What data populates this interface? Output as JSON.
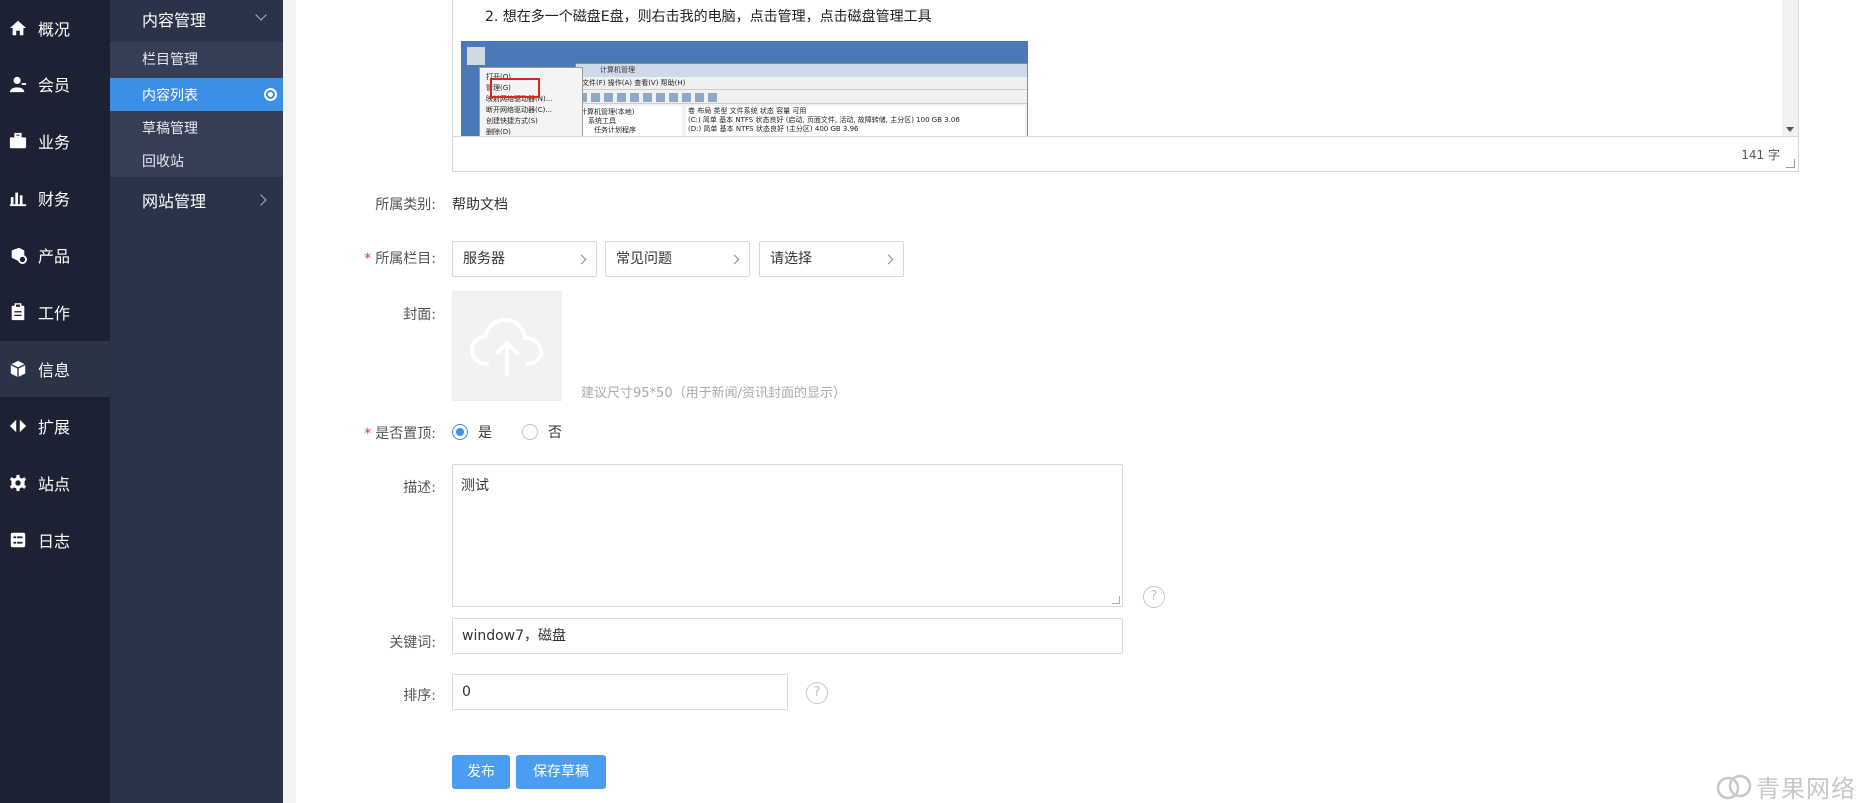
{
  "primary_nav": [
    {
      "label": "概况",
      "icon": "home-icon"
    },
    {
      "label": "会员",
      "icon": "user-icon"
    },
    {
      "label": "业务",
      "icon": "briefcase-icon"
    },
    {
      "label": "财务",
      "icon": "bar-chart-icon"
    },
    {
      "label": "产品",
      "icon": "product-icon"
    },
    {
      "label": "工作",
      "icon": "clipboard-icon"
    },
    {
      "label": "信息",
      "icon": "cube-icon"
    },
    {
      "label": "扩展",
      "icon": "code-icon"
    },
    {
      "label": "站点",
      "icon": "gear-icon"
    },
    {
      "label": "日志",
      "icon": "log-icon"
    }
  ],
  "secondary_nav": {
    "content_group": "内容管理",
    "items": [
      "栏目管理",
      "内容列表",
      "草稿管理",
      "回收站"
    ],
    "site_group": "网站管理"
  },
  "editor": {
    "line": "2. 想在多一个磁盘E盘，则右击我的电脑，点击管理，点击磁盘管理工具",
    "word_count": "141 字",
    "screenshot": {
      "window_title": "计算机管理",
      "menu": "文件(F)   操作(A)   查看(V)   帮助(H)",
      "context_menu": [
        "打开(O)",
        "管理(G)",
        "映射网络驱动器(N)...",
        "断开网络驱动器(C)...",
        "创建快捷方式(S)",
        "删除(D)"
      ],
      "tree": [
        "计算机管理(本地)",
        "系统工具",
        "任务计划程序"
      ],
      "grid_header": "卷   布局  类型  文件系统  状态                         容量     可用",
      "grid_rows": [
        "(C:)   简单  基本  NTFS  状态良好 (启动, 页面文件, 活动, 故障转储, 主分区)  100 GB  3.06",
        "(D:)   简单  基本  NTFS  状态良好 (主分区)                      400 GB  3.96"
      ]
    }
  },
  "form": {
    "category_label": "所属类别:",
    "category_value": "帮助文档",
    "column_label": "所属栏目:",
    "column_pickers": [
      "服务器",
      "常见问题",
      "请选择"
    ],
    "cover_label": "封面:",
    "cover_hint": "建议尺寸95*50（用于新闻/资讯封面的显示）",
    "top_label": "是否置顶:",
    "top_yes": "是",
    "top_no": "否",
    "top_selected": "是",
    "desc_label": "描述:",
    "desc_value": "测试",
    "keywords_label": "关键词:",
    "keywords_value": "window7，磁盘",
    "sort_label": "排序:",
    "sort_value": "0",
    "help_glyph": "?",
    "required_mark": "*"
  },
  "actions": {
    "publish": "发布",
    "save_draft": "保存草稿"
  },
  "watermark": "青果网络",
  "colors": {
    "accent": "#3b8fe6",
    "primary_nav_bg": "#1c2233",
    "secondary_nav_bg": "#2b3348"
  }
}
